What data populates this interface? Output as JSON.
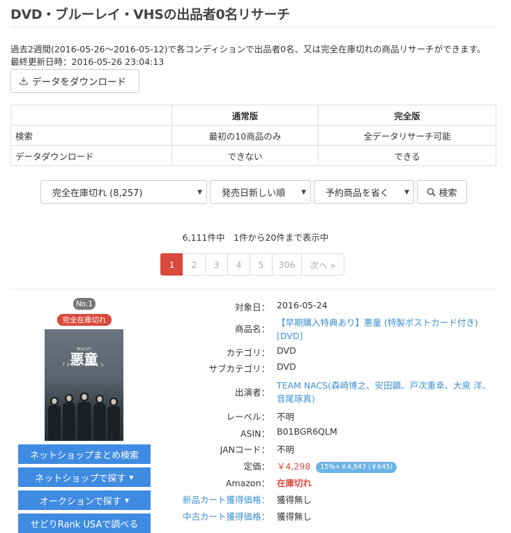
{
  "page": {
    "title": "DVD・ブルーレイ・VHSの出品者0名リサーチ",
    "description": "過去2週間(2016-05-26〜2016-05-12)で各コンディションで出品者0名、又は完全在庫切れの商品リサーチができます。",
    "last_updated": "最終更新日時：2016-05-26 23:04:13",
    "download_button": "データをダウンロード"
  },
  "comparison": {
    "headers": [
      "",
      "通常版",
      "完全版"
    ],
    "rows": [
      [
        "検索",
        "最初の10商品のみ",
        "全データリサーチ可能"
      ],
      [
        "データダウンロード",
        "できない",
        "できる"
      ]
    ]
  },
  "filters": {
    "stock": "完全在庫切れ (8,257)",
    "sort": "発売日新しい順",
    "reserve": "予約商品を省く",
    "search_button": "検索"
  },
  "results": {
    "count_text": "6,111件中　1件から20件まで表示中"
  },
  "pagination": {
    "pages": [
      "1",
      "2",
      "3",
      "4",
      "5",
      "306",
      "次へ »"
    ],
    "active": "1"
  },
  "item": {
    "rank": "No.1",
    "stock_badge": "完全在庫切れ",
    "cover": {
      "small": "舞台DVD",
      "big": "悪童",
      "team": "TEAM NACS"
    },
    "buttons": {
      "netshop_search": "ネットショップまとめ検索",
      "netshop_find": "ネットショップで探す",
      "auction_find": "オークションで探す",
      "sedori": "せどりRank USAで調べる"
    },
    "fields": {
      "date_label": "対象日：",
      "date": "2016-05-24",
      "name_label": "商品名：",
      "name_line1": "【早期購入特典あり】悪童 (特製ポストカード付き)",
      "name_line2": "[DVD]",
      "category_label": "カテゴリ：",
      "category": "DVD",
      "subcategory_label": "サブカテゴリ：",
      "subcategory": "DVD",
      "cast_label": "出演者：",
      "cast_line1": "TEAM NACS(森崎博之、安田顕、戸次重幸、大泉 洋、",
      "cast_line2": "音尾琢真)",
      "label_label": "レーベル：",
      "label": "不明",
      "asin_label": "ASIN：",
      "asin": "B01BGR6QLM",
      "jan_label": "JANコード：",
      "jan": "不明",
      "price_label": "定価：",
      "price": "￥4,298",
      "price_badge": "15%+￥4,943 (￥645)",
      "amazon_label": "Amazon：",
      "amazon": "在庫切れ",
      "new_cart_label": "新品カート獲得価格：",
      "new_cart": "獲得無し",
      "used_cart_label": "中古カート獲得価格：",
      "used_cart": "獲得無し"
    }
  },
  "colors": {
    "accent_red": "#d9493b",
    "button_blue": "#3f8be2",
    "link_blue": "#3e8fcd",
    "badge_gray": "#777777",
    "price_badge_blue": "#6cb3e6"
  },
  "icons": {
    "download": "download-icon",
    "search": "search-icon",
    "caret": "caret-down-icon"
  }
}
